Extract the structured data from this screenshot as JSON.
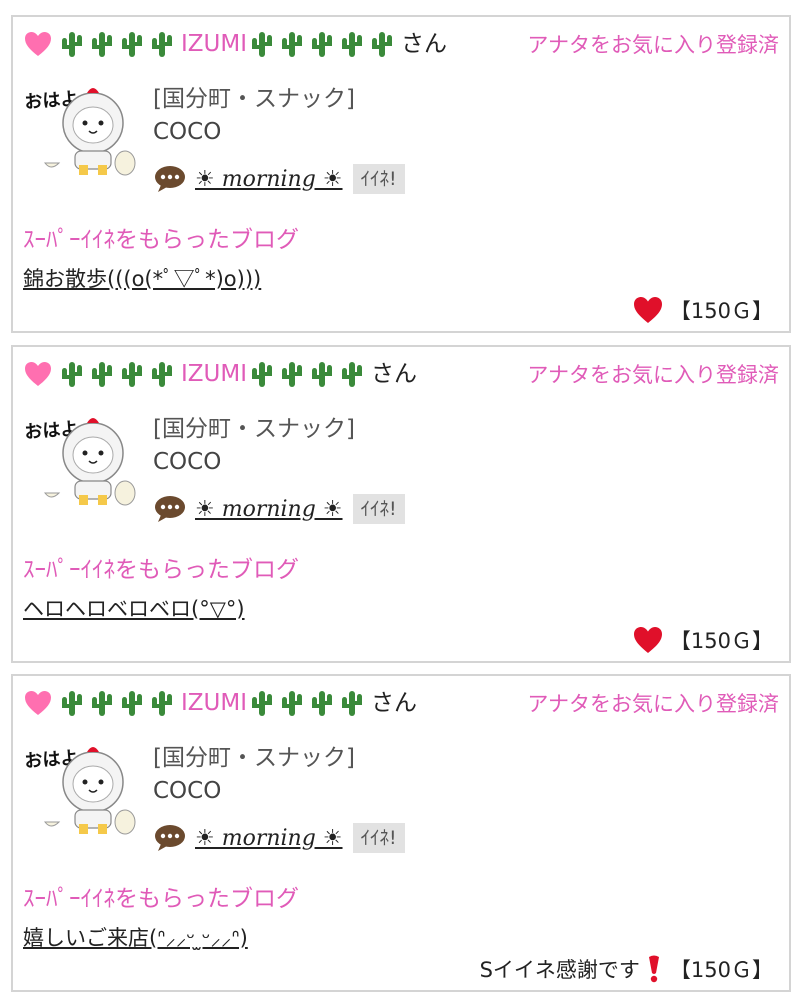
{
  "colors": {
    "pink": "#e05bb8",
    "heart_light": "#ff6fb0",
    "heart_red": "#e0102a",
    "cactus": "#3a8a3a",
    "border": "#d4d4d4",
    "button_bg": "#e2e2e2"
  },
  "posts": [
    {
      "user_name": "IZUMI",
      "san": "さん",
      "fav_status": "アナタをお気に入り登録済",
      "shop_name": "[国分町・スナック]",
      "cast_name": "COCO",
      "comment_link": "☀ morning ☀",
      "iine_label": "ｲｲﾈ!",
      "super_heading": "ｽｰﾊﾟｰｲｲﾈをもらったブログ",
      "blog_title": "錦お散歩(((o(*ﾟ▽ﾟ*)o)))",
      "thanks_text": "",
      "points": "【150Ｇ】"
    },
    {
      "user_name": "IZUMI",
      "san": "さん",
      "fav_status": "アナタをお気に入り登録済",
      "shop_name": "[国分町・スナック]",
      "cast_name": "COCO",
      "comment_link": "☀ morning ☀",
      "iine_label": "ｲｲﾈ!",
      "super_heading": "ｽｰﾊﾟｰｲｲﾈをもらったブログ",
      "blog_title": "ヘロヘロベロベロ(°▽°)",
      "thanks_text": "",
      "points": "【150Ｇ】"
    },
    {
      "user_name": "IZUMI",
      "san": "さん",
      "fav_status": "アナタをお気に入り登録済",
      "shop_name": "[国分町・スナック]",
      "cast_name": "COCO",
      "comment_link": "☀ morning ☀",
      "iine_label": "ｲｲﾈ!",
      "super_heading": "ｽｰﾊﾟｰｲｲﾈをもらったブログ",
      "blog_title": "嬉しいご来店(ᐢ⸝⸝ᵕ ̫ᵕ⸝⸝ᐢ)",
      "thanks_text": "Sイイネ感謝です",
      "points": "【150Ｇ】"
    }
  ],
  "avatar_text": "おはよ~",
  "icons": {
    "heart": "heart-icon",
    "cactus": "cactus-icon",
    "comment": "speech-bubble-icon",
    "big_heart": "red-heart-icon",
    "exclaim": "red-exclamation-icon"
  }
}
